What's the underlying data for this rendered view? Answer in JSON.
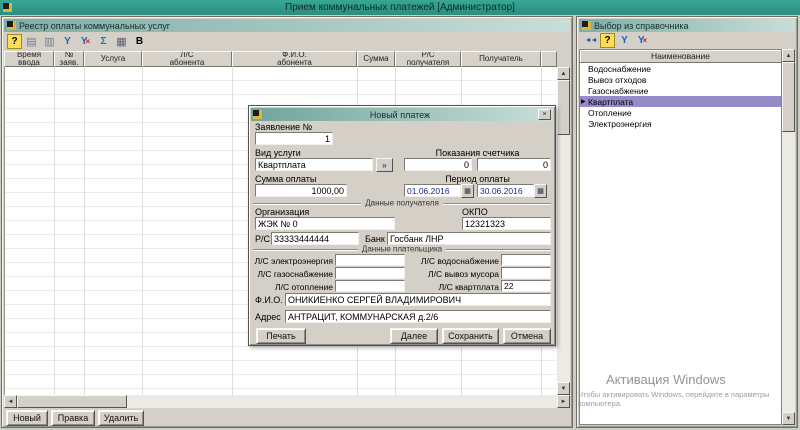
{
  "app": {
    "title": "Прием коммунальных платежей [Администратор]"
  },
  "icons": {
    "up": "▲",
    "down": "▼",
    "left": "◄",
    "right": "►"
  },
  "registry_window": {
    "title": "Реестр оплаты коммунальных услуг",
    "toolbar_icons": [
      {
        "name": "help-icon",
        "glyph": "?"
      },
      {
        "name": "report-icon",
        "glyph": "▤"
      },
      {
        "name": "print-icon",
        "glyph": "▥"
      },
      {
        "name": "filter-icon",
        "glyph": "Y"
      },
      {
        "name": "filter-clear-icon",
        "glyph": "Y",
        "badge": "×"
      },
      {
        "name": "sum-icon",
        "glyph": "Σ"
      },
      {
        "name": "calculator-icon",
        "glyph": "▦"
      },
      {
        "name": "bold-icon",
        "glyph": "B"
      }
    ],
    "columns": [
      "Время\nввода",
      "№\nзаяв.",
      "Услуга",
      "Л/С\nабонента",
      "Ф.И.О.\nабонента",
      "Сумма",
      "Р/С\nполучателя",
      "Получатель"
    ],
    "footer_buttons": {
      "new": "Новый",
      "edit": "Правка",
      "delete": "Удалить"
    }
  },
  "dictionary_window": {
    "title": "Выбор из справочника",
    "toolbar_icons": [
      {
        "name": "select-icon",
        "glyph": "◄◄"
      },
      {
        "name": "help-icon",
        "glyph": "?"
      },
      {
        "name": "filter-icon",
        "glyph": "Y"
      },
      {
        "name": "filter-clear-icon",
        "glyph": "Y",
        "badge": "×"
      }
    ],
    "column_header": "Наименование",
    "items": [
      "Водоснабжение",
      "Вывоз отходов",
      "Газоснабжение",
      "Квартплата",
      "Отопление",
      "Электроэнергия"
    ],
    "selected_index": 3,
    "selected_item": "Квартплата",
    "selected_marker": "▶"
  },
  "dialog": {
    "title": "Новый платеж",
    "icons": {
      "picker": "»",
      "calendar": "▦",
      "close": "×"
    },
    "application": {
      "label": "Заявление №",
      "value": "1"
    },
    "service": {
      "label": "Вид услуги",
      "value": "Квартплата"
    },
    "meter": {
      "label": "Показания счетчика",
      "value1": "0",
      "value2": "0"
    },
    "amount": {
      "label": "Сумма оплаты",
      "value": "1000,00"
    },
    "period": {
      "label": "Период оплаты",
      "from": "01.06.2016",
      "to": "30.06.2016"
    },
    "recipient_section": "Данные получателя",
    "organization": {
      "label": "Организация",
      "value": "ЖЭК № 0"
    },
    "okpo": {
      "label": "ОКПО",
      "value": "12321323"
    },
    "account": {
      "label": "Р/С",
      "value": "33333444444"
    },
    "bank": {
      "label": "Банк",
      "value": "Госбанк ЛНР"
    },
    "payer_section": "Данные плательщика",
    "ls": {
      "electricity": {
        "label": "Л/С электроэнергия",
        "value": ""
      },
      "water": {
        "label": "Л/С водоснабжение",
        "value": ""
      },
      "gas": {
        "label": "Л/С газоснабжение",
        "value": ""
      },
      "trash": {
        "label": "Л/С вывоз мусора",
        "value": ""
      },
      "heating": {
        "label": "Л/С отопление",
        "value": ""
      },
      "rent": {
        "label": "Л/С квартплата",
        "value": "22"
      }
    },
    "fio": {
      "label": "Ф.И.О.",
      "value": "ОНИКИЕНКО СЕРГЕЙ ВЛАДИМИРОВИЧ"
    },
    "address": {
      "label": "Адрес",
      "value": "АНТРАЦИТ, КОММУНАРСКАЯ д.2/6"
    },
    "buttons": {
      "print": "Печать",
      "next": "Далее",
      "save": "Сохранить",
      "cancel": "Отмена"
    }
  },
  "activation": {
    "title": "Активация Windows",
    "line1": "Чтобы активировать Windows, перейдите в параметры",
    "line2": "компьютера."
  }
}
